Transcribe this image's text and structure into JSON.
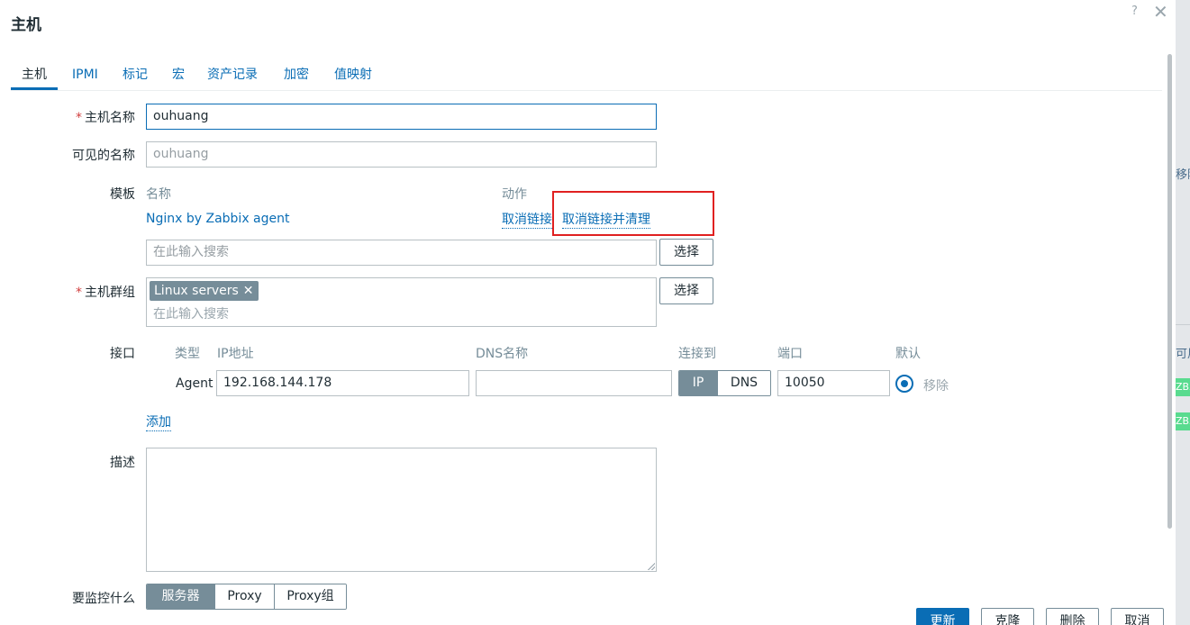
{
  "dialog": {
    "title": "主机",
    "help_glyph": "?",
    "close_glyph": "✕"
  },
  "tabs": [
    {
      "label": "主机",
      "active": true
    },
    {
      "label": "IPMI"
    },
    {
      "label": "标记"
    },
    {
      "label": "宏"
    },
    {
      "label": "资产记录"
    },
    {
      "label": "加密"
    },
    {
      "label": "值映射"
    }
  ],
  "form": {
    "required_mark": "*",
    "host_name": {
      "label": "主机名称",
      "value": "ouhuang"
    },
    "visible_name": {
      "label": "可见的名称",
      "placeholder": "ouhuang"
    },
    "templates": {
      "label": "模板",
      "col_name": "名称",
      "col_action": "动作",
      "rows": [
        {
          "name": "Nginx by Zabbix agent",
          "unlink": "取消链接",
          "unlink_clear": "取消链接并清理"
        }
      ],
      "search_placeholder": "在此输入搜索",
      "select_label": "选择"
    },
    "host_groups": {
      "label": "主机群组",
      "chips": [
        {
          "label": "Linux servers",
          "remove": "✕"
        }
      ],
      "search_placeholder": "在此输入搜索",
      "select_label": "选择"
    },
    "interfaces": {
      "label": "接口",
      "col_type": "类型",
      "col_ip": "IP地址",
      "col_dns": "DNS名称",
      "col_connect": "连接到",
      "col_port": "端口",
      "col_default": "默认",
      "rows": [
        {
          "type": "Agent",
          "ip": "192.168.144.178",
          "dns": "",
          "connect_ip": "IP",
          "connect_dns": "DNS",
          "connect_selected": "IP",
          "port": "10050",
          "default": true,
          "remove": "移除"
        }
      ],
      "add_label": "添加"
    },
    "description": {
      "label": "描述",
      "value": ""
    },
    "monitored_by": {
      "label": "要监控什么",
      "options": [
        "服务器",
        "Proxy",
        "Proxy组"
      ],
      "selected": "服务器"
    }
  },
  "footer": {
    "update": "更新",
    "clone": "克隆",
    "delete": "删除",
    "cancel": "取消"
  },
  "background": {
    "frag1": "移除",
    "frag2": "可用",
    "tag1": "ZBX",
    "tag2": "ZBX"
  },
  "colors": {
    "accent": "#0a6db5",
    "highlight_box": "#e02020",
    "chip": "#768d99"
  }
}
